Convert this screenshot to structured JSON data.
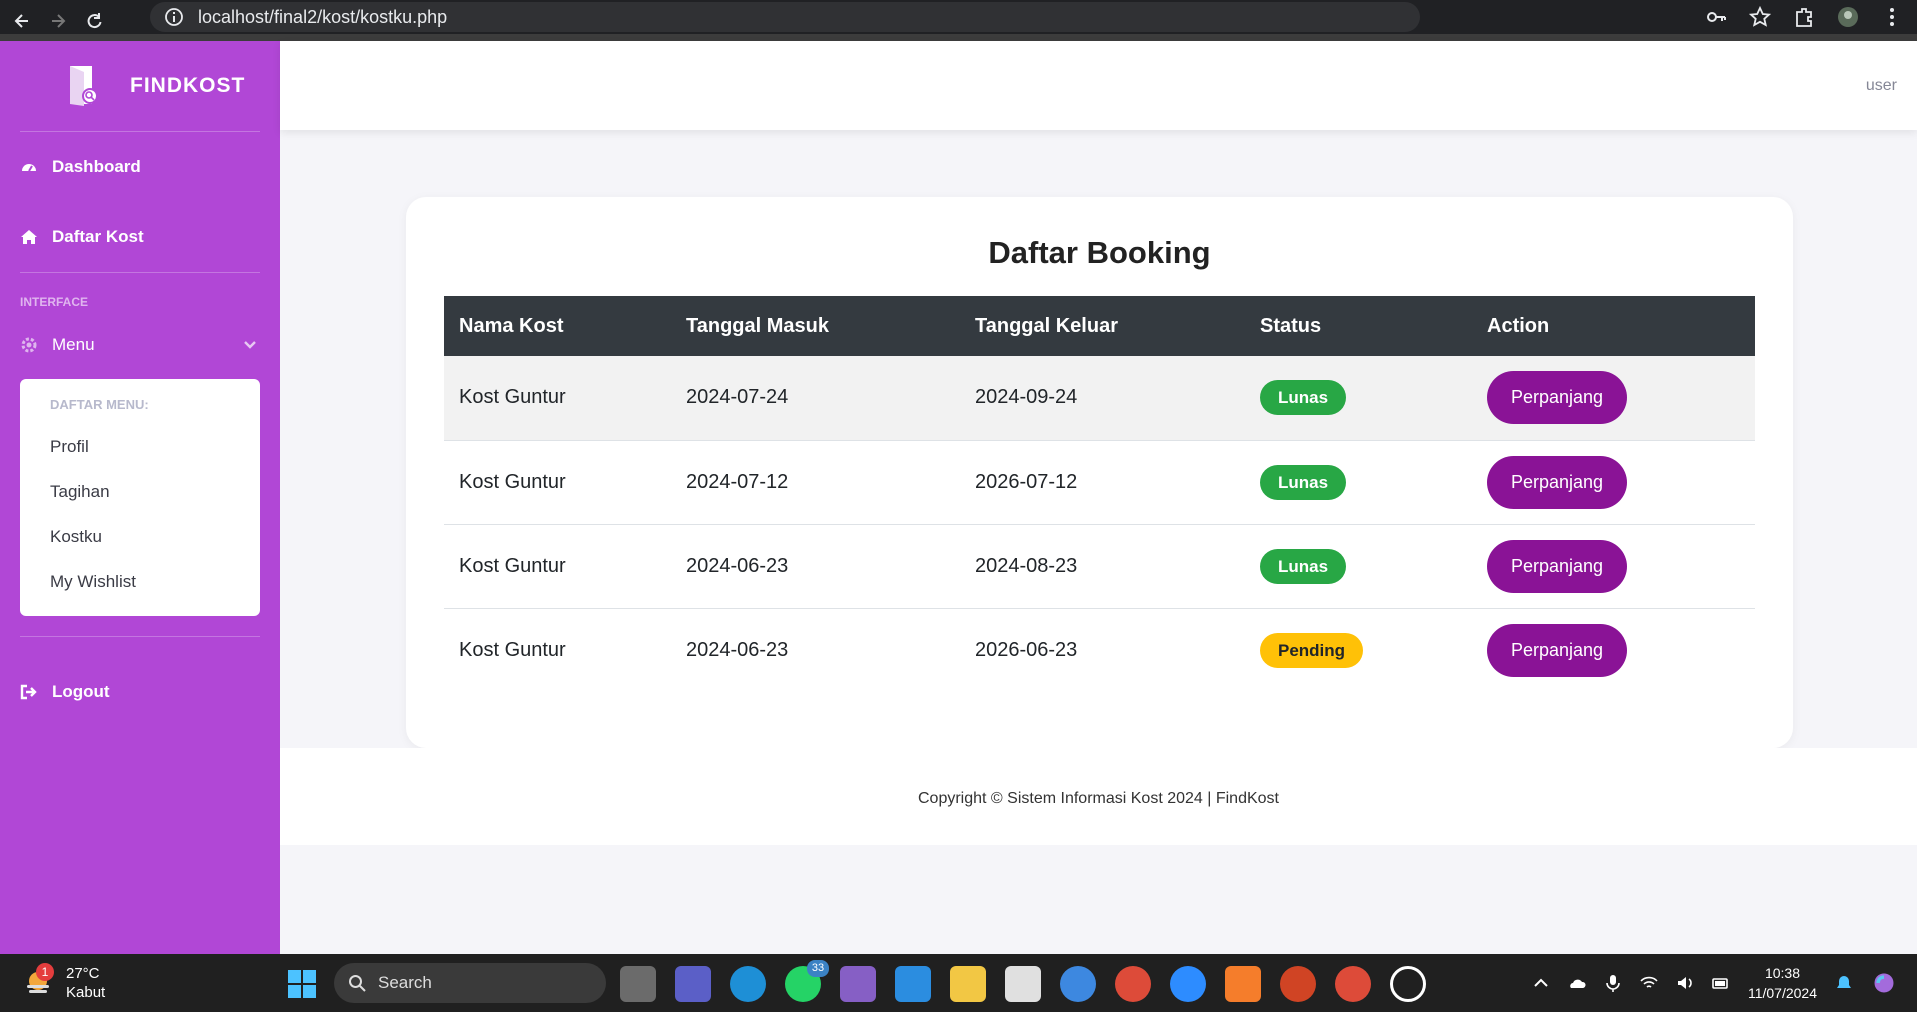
{
  "browser": {
    "url": "localhost/final2/kost/kostku.php"
  },
  "sidebar": {
    "brand": "FINDKOST",
    "items": [
      {
        "label": "Dashboard"
      },
      {
        "label": "Daftar Kost"
      }
    ],
    "section_heading": "INTERFACE",
    "menu_label": "Menu",
    "submenu": {
      "heading": "DAFTAR MENU:",
      "items": [
        "Profil",
        "Tagihan",
        "Kostku",
        "My Wishlist"
      ]
    },
    "logout_label": "Logout",
    "accent_color": "#b147d6"
  },
  "topbar": {
    "user": "user"
  },
  "main": {
    "title": "Daftar Booking",
    "columns": [
      "Nama Kost",
      "Tanggal Masuk",
      "Tanggal Keluar",
      "Status",
      "Action"
    ],
    "rows": [
      {
        "nama": "Kost Guntur",
        "masuk": "2024-07-24",
        "keluar": "2024-09-24",
        "status": "Lunas",
        "action": "Perpanjang"
      },
      {
        "nama": "Kost Guntur",
        "masuk": "2024-07-12",
        "keluar": "2026-07-12",
        "status": "Lunas",
        "action": "Perpanjang"
      },
      {
        "nama": "Kost Guntur",
        "masuk": "2024-06-23",
        "keluar": "2024-08-23",
        "status": "Lunas",
        "action": "Perpanjang"
      },
      {
        "nama": "Kost Guntur",
        "masuk": "2024-06-23",
        "keluar": "2026-06-23",
        "status": "Pending",
        "action": "Perpanjang"
      }
    ],
    "status_colors": {
      "Lunas": "#28a745",
      "Pending": "#ffc107"
    },
    "button_color": "#8a1396"
  },
  "footer": {
    "text": "Copyright © Sistem Informasi Kost 2024 | FindKost"
  },
  "taskbar": {
    "weather_temp": "27°C",
    "weather_desc": "Kabut",
    "weather_badge": "1",
    "search_label": "Search",
    "whatsapp_badge": "33",
    "time": "10:38",
    "date": "11/07/2024"
  }
}
